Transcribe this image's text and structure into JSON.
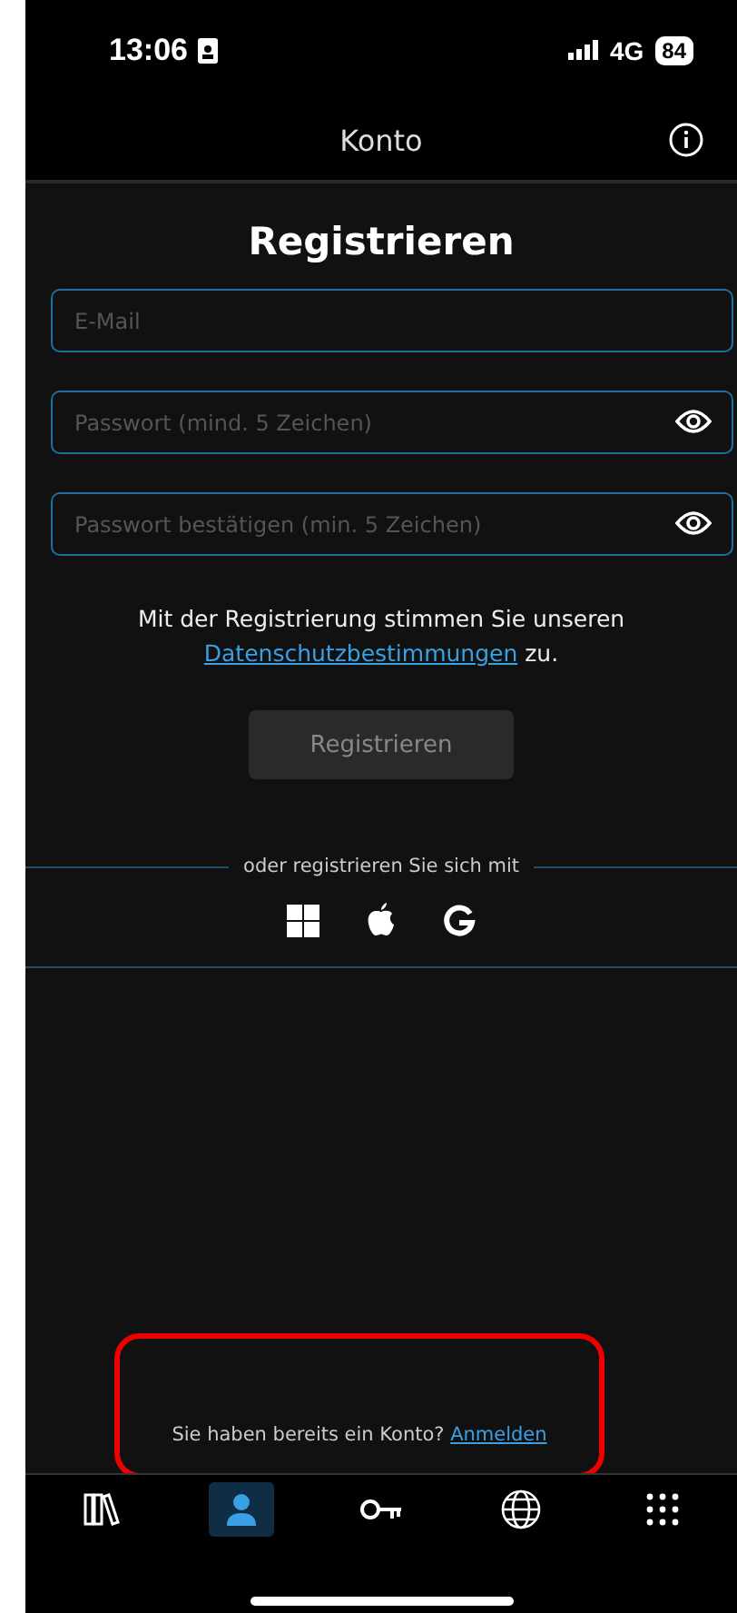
{
  "status_bar": {
    "time": "13:06",
    "network": "4G",
    "battery": "84"
  },
  "header": {
    "title": "Konto"
  },
  "form": {
    "title": "Registrieren",
    "fields": [
      {
        "placeholder": "E-Mail",
        "kind": "text"
      },
      {
        "placeholder": "Passwort (mind. 5 Zeichen)",
        "kind": "password"
      },
      {
        "placeholder": "Passwort bestätigen (min. 5 Zeichen)",
        "kind": "password"
      }
    ],
    "terms": {
      "text": "Mit der Registrierung stimmen Sie unseren",
      "link": "Datenschutzbestimmungen",
      "suffix": "zu."
    },
    "submit": {
      "label": "Registrieren",
      "disabled": true
    },
    "divider_text": "oder registrieren Sie sich mit",
    "providers": [
      {
        "kind": "windows"
      },
      {
        "kind": "apple"
      },
      {
        "kind": "google"
      }
    ]
  },
  "login_prompt": {
    "text": "Sie haben bereits ein Konto?",
    "link": "Anmelden",
    "highlighted": true
  },
  "tabs": [
    {
      "kind": "library",
      "selected": false
    },
    {
      "kind": "account",
      "selected": true
    },
    {
      "kind": "key",
      "selected": false
    },
    {
      "kind": "news",
      "selected": false
    },
    {
      "kind": "more",
      "selected": false
    }
  ]
}
